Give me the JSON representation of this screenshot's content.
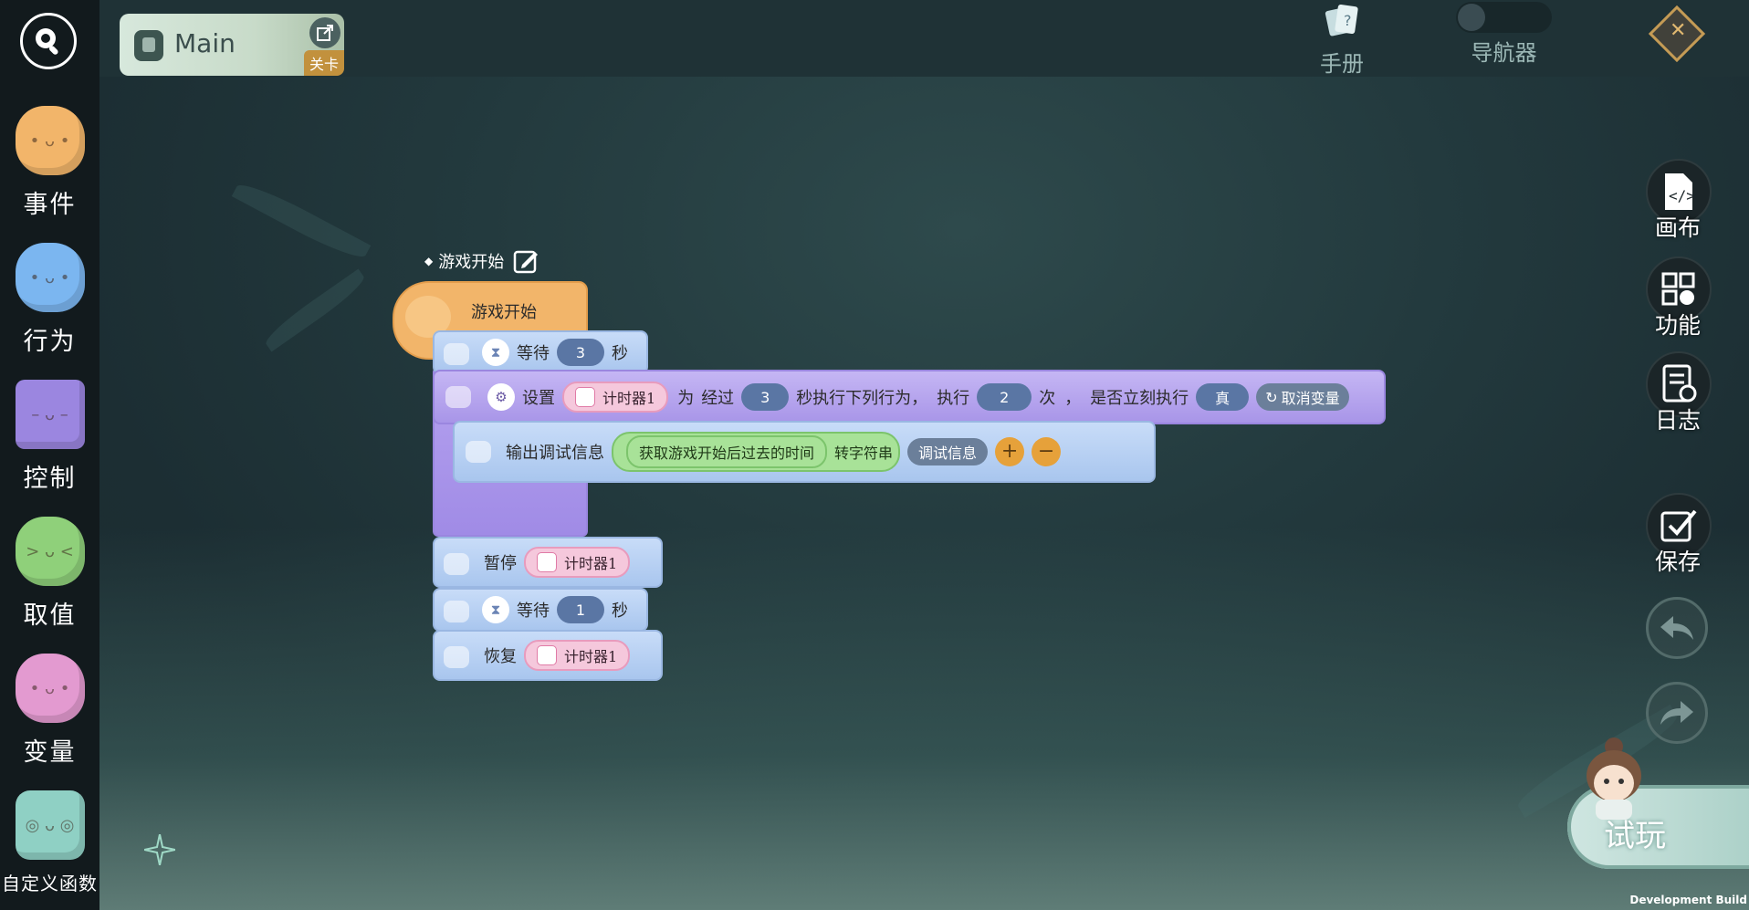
{
  "sidebar": {
    "categories": [
      {
        "label": "事件",
        "color": "#f2b56a"
      },
      {
        "label": "行为",
        "color": "#7bb6f0"
      },
      {
        "label": "控制",
        "color": "#9b86e0"
      },
      {
        "label": "取值",
        "color": "#8fd07a"
      },
      {
        "label": "变量",
        "color": "#e39ad0"
      },
      {
        "label": "自定义函数",
        "color": "#8fd0c4"
      }
    ]
  },
  "header": {
    "tab_title": "Main",
    "tab_badge": "关卡",
    "manual_label": "手册",
    "navigator_label": "导航器"
  },
  "right_tools": {
    "canvas": "画布",
    "function": "功能",
    "log": "日志",
    "save": "保存"
  },
  "script": {
    "event_header": "游戏开始",
    "event_block": "游戏开始",
    "wait1": {
      "label": "等待",
      "value": "3",
      "unit": "秒"
    },
    "setup": {
      "label": "设置",
      "timer": "计时器1",
      "for": "为",
      "after": "经过",
      "seconds": "3",
      "exec_text": "秒执行下列行为，",
      "exec": "执行",
      "times": "2",
      "times_unit": "次",
      "comma": "，",
      "immediate": "是否立刻执行",
      "bool": "真",
      "cancel_var": "取消变量"
    },
    "debug": {
      "label": "输出调试信息",
      "get_time": "获取游戏开始后过去的时间",
      "to_string": "转字符串",
      "info": "调试信息"
    },
    "pause": {
      "label": "暂停",
      "timer": "计时器1"
    },
    "wait2": {
      "label": "等待",
      "value": "1",
      "unit": "秒"
    },
    "resume": {
      "label": "恢复",
      "timer": "计时器1"
    }
  },
  "play_button": "试玩",
  "dev_build": "Development Build"
}
